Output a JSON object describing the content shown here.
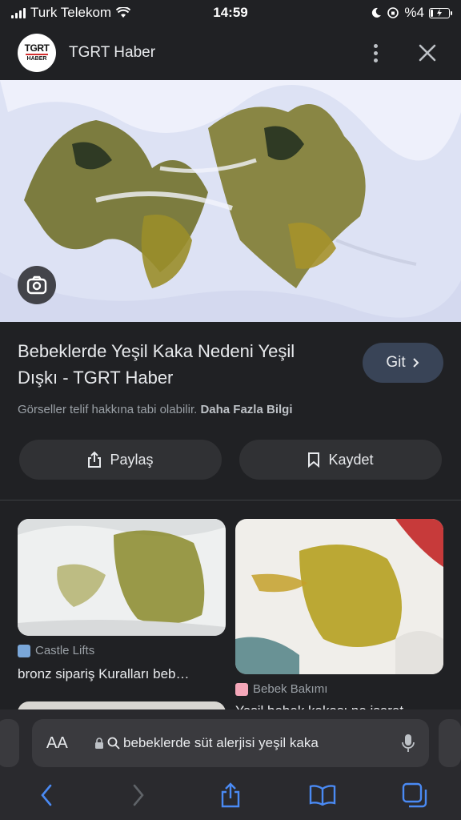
{
  "status_bar": {
    "carrier": "Turk Telekom",
    "time": "14:59",
    "battery": "%4"
  },
  "header": {
    "site_name": "TGRT Haber",
    "logo_text_top": "TGRT",
    "logo_text_bottom": "HABER"
  },
  "result": {
    "title": "Bebeklerde Yeşil Kaka Nedeni Yeşil Dışkı - TGRT Haber",
    "visit_label": "Git",
    "copyright_text": "Görseller telif hakkına tabi olabilir.",
    "more_info_label": "Daha Fazla Bilgi",
    "share_label": "Paylaş",
    "save_label": "Kaydet"
  },
  "related": [
    {
      "source": "Castle Lifts",
      "caption": "bronz sipariş Kuralları beb…",
      "favicon_color": "#7aa7d9"
    },
    {
      "source": "Bebek Bakımı",
      "caption": "Yeşil bebek kakası ne işaret…",
      "favicon_color": "#f4a7b9"
    }
  ],
  "browser": {
    "aa_label": "AA",
    "url_text": "bebeklerde süt alerjisi yeşil kaka"
  },
  "colors": {
    "background": "#202124",
    "button_bg": "#303134",
    "visit_bg": "#394457",
    "accent_blue": "#4a8af4"
  }
}
